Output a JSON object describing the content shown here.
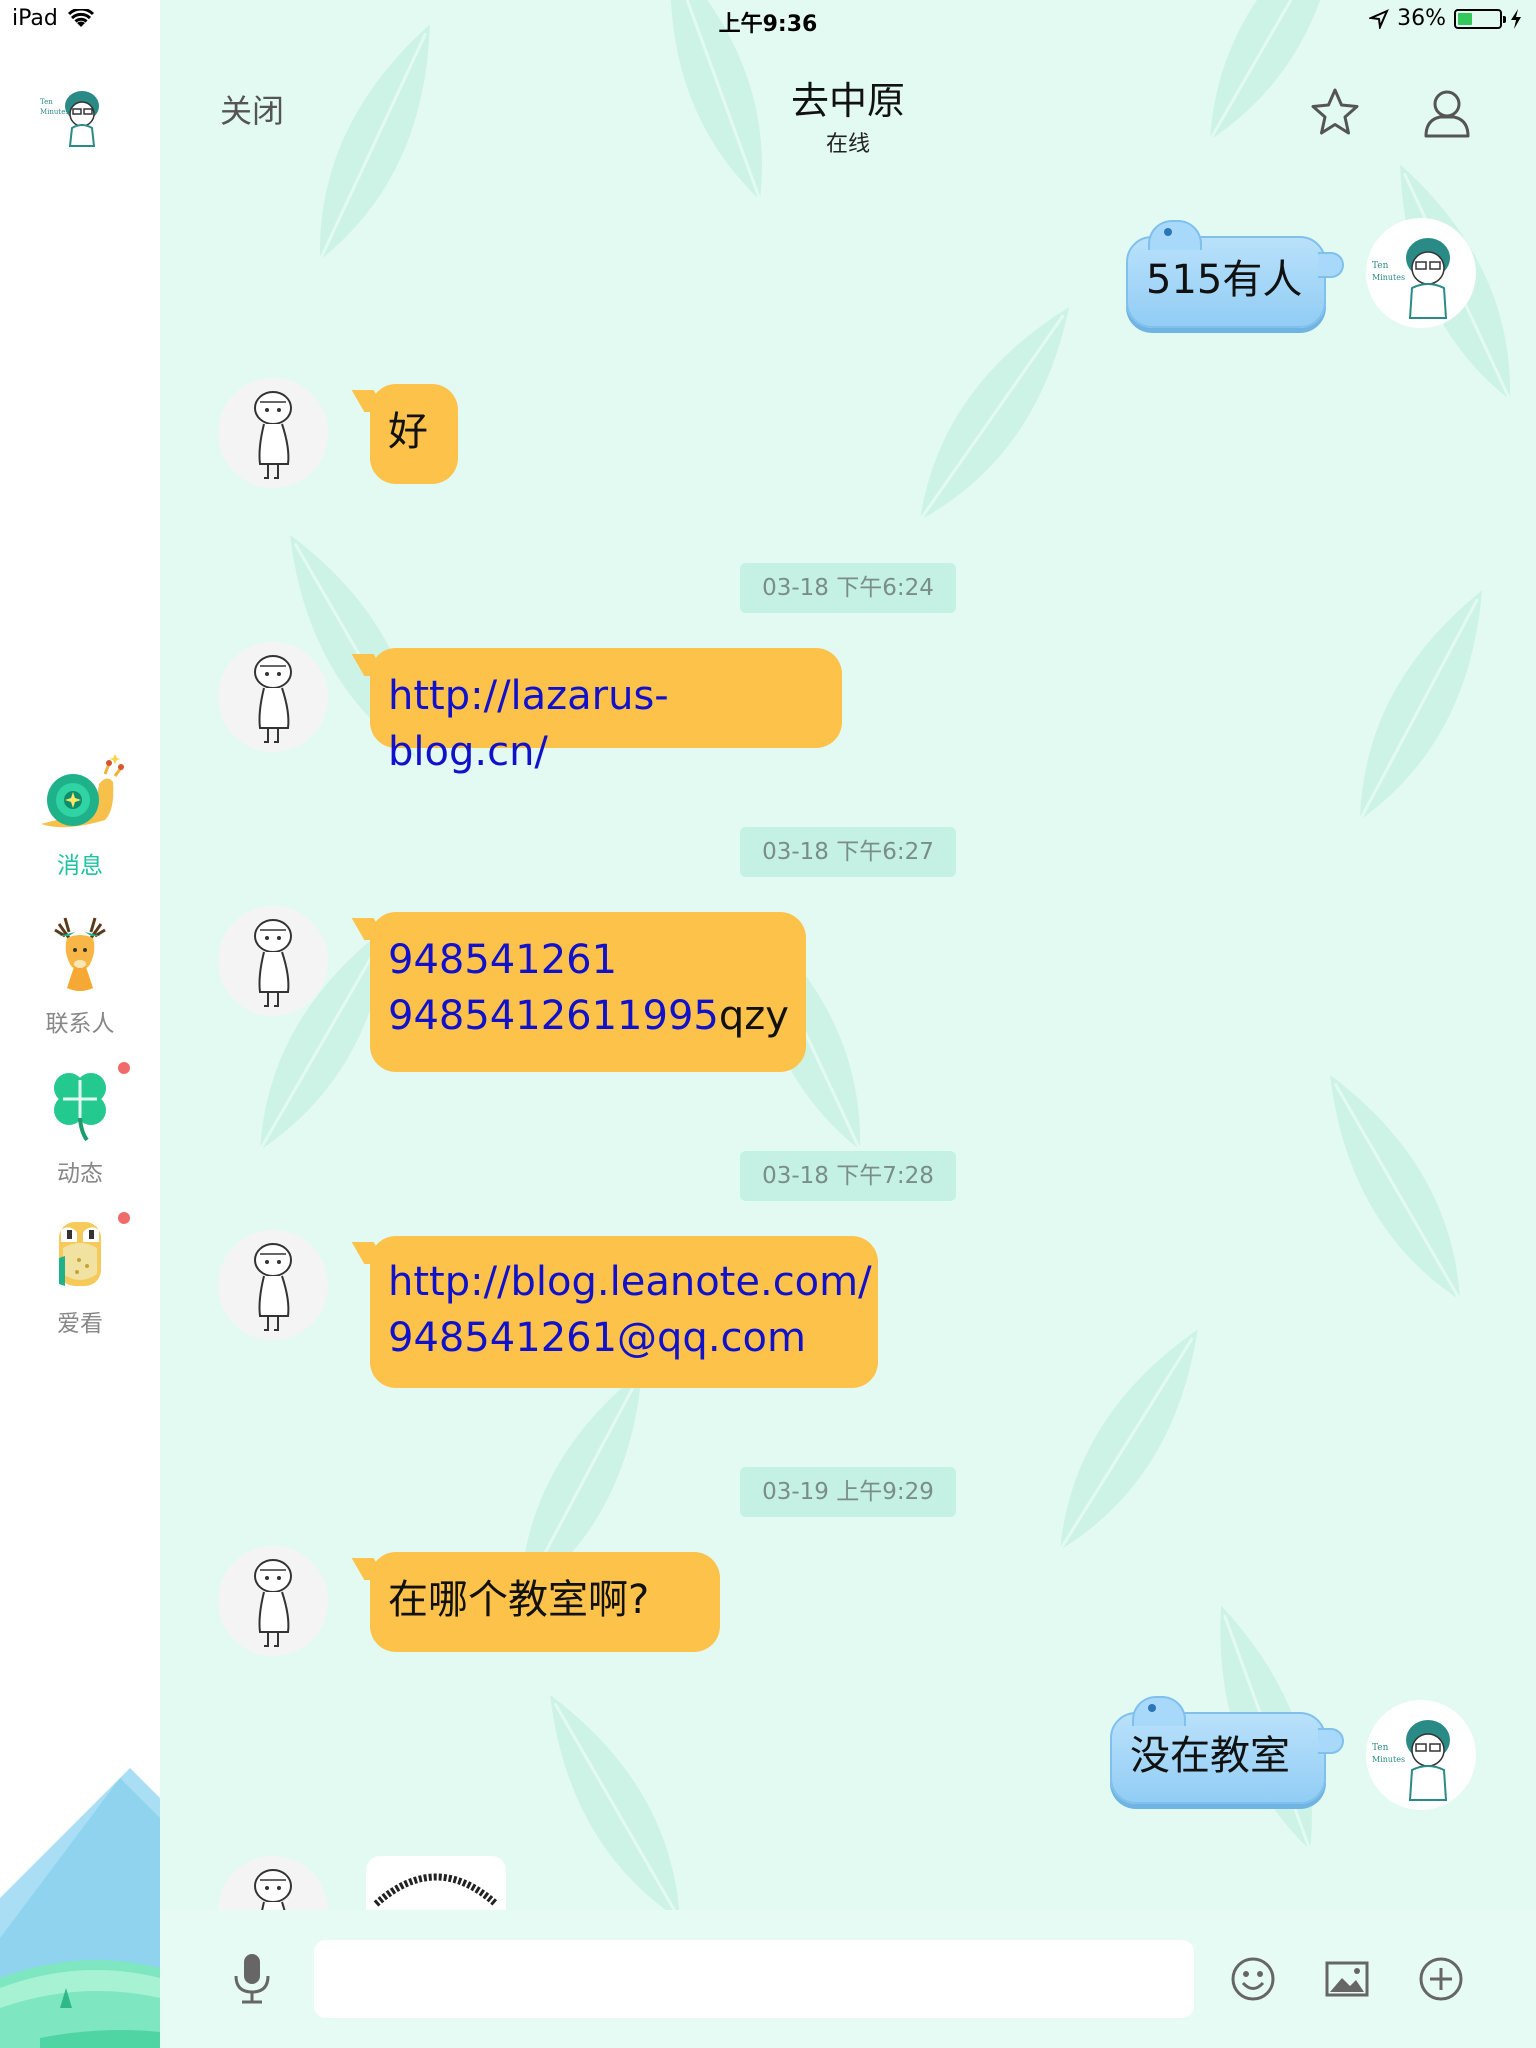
{
  "status_bar": {
    "device": "iPad",
    "time": "上午9:36",
    "battery": "36%",
    "battery_level": 0.36
  },
  "sidebar": {
    "items": [
      {
        "label": "消息",
        "icon": "snail-icon",
        "active": true,
        "badge": false
      },
      {
        "label": "联系人",
        "icon": "deer-icon",
        "active": false,
        "badge": false
      },
      {
        "label": "动态",
        "icon": "clover-icon",
        "active": false,
        "badge": true
      },
      {
        "label": "爱看",
        "icon": "owl-icon",
        "active": false,
        "badge": true
      }
    ]
  },
  "header": {
    "close_label": "关闭",
    "title": "去中原",
    "subtitle": "在线",
    "star_icon": "star-icon",
    "profile_icon": "user-icon"
  },
  "messages": [
    {
      "type": "msg",
      "side": "right",
      "lines": [
        "515有人"
      ]
    },
    {
      "type": "msg",
      "side": "left",
      "lines": [
        "好"
      ]
    },
    {
      "type": "time",
      "text": "03-18 下午6:24"
    },
    {
      "type": "msg",
      "side": "left",
      "lines": [
        "http://lazarus-blog.cn/"
      ]
    },
    {
      "type": "time",
      "text": "03-18 下午6:27"
    },
    {
      "type": "msg",
      "side": "left",
      "lines": [
        "948541261",
        "9485412611995qzy"
      ]
    },
    {
      "type": "time",
      "text": "03-18 下午7:28"
    },
    {
      "type": "msg",
      "side": "left",
      "lines": [
        "http://blog.leanote.com/",
        "948541261@qq.com"
      ]
    },
    {
      "type": "time",
      "text": "03-19 上午9:29"
    },
    {
      "type": "msg",
      "side": "left",
      "lines": [
        "在哪个教室啊?"
      ]
    },
    {
      "type": "msg",
      "side": "right",
      "lines": [
        "没在教室"
      ]
    },
    {
      "type": "image",
      "side": "left"
    }
  ],
  "input_bar": {
    "mic_icon": "microphone-icon",
    "emoji_icon": "emoji-icon",
    "image_icon": "image-icon",
    "plus_icon": "plus-icon",
    "placeholder": ""
  },
  "colors": {
    "accent": "#1fc3a1",
    "background": "#e3faf3",
    "left_bubble": "#fcc24a",
    "right_bubble": "#a9d9fa",
    "link": "#1111cc",
    "badge": "#f06a6a"
  }
}
